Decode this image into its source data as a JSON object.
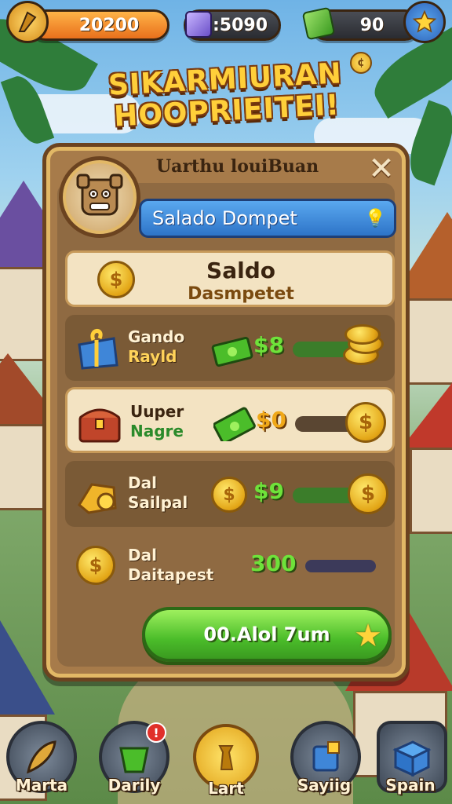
{
  "hud": {
    "coins_value": "20200",
    "gems_value": ":5090",
    "cash_value": "90"
  },
  "title": {
    "line1": "SIKARMIURAN",
    "line2": "HOOPRIEITEI!"
  },
  "panel": {
    "header": "Uarthu louiBuan",
    "wallet_label": "Salado Dompet",
    "saldo": {
      "title": "Saldo",
      "subtitle": "Dasmpetet"
    },
    "rows": [
      {
        "line1": "Gando",
        "line2": "Rayld",
        "value": "$8"
      },
      {
        "line1": "Uuper",
        "line2": "Nagre",
        "value": "$0"
      },
      {
        "line1": "Dal",
        "line2": "Sailpal",
        "value": "$9"
      },
      {
        "line1": "Dal",
        "line2": "Daitapest",
        "value": "300"
      }
    ],
    "cta_label": "00.Alol 7um"
  },
  "nav": {
    "items": [
      {
        "label": "Marta",
        "icon": "feather-icon"
      },
      {
        "label": "Darily",
        "icon": "bucket-icon"
      },
      {
        "label": "Lart",
        "icon": "coin-icon"
      },
      {
        "label": "Sayiig",
        "icon": "box-icon"
      },
      {
        "label": "Spain",
        "icon": "chest-icon"
      }
    ]
  },
  "colors": {
    "gold": "#ffcf3a",
    "panel_wood": "#a77b4a",
    "wallet_blue": "#2e74c8",
    "cta_green": "#4bbd2a",
    "value_green": "#6ee23a"
  }
}
